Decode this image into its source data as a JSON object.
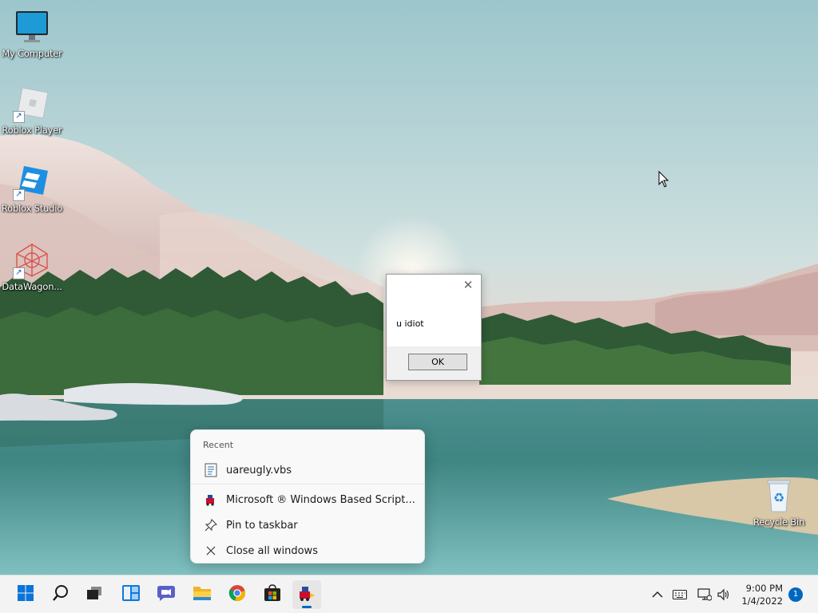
{
  "desktop": {
    "icons": [
      {
        "label": "My Computer",
        "icon": "monitor-icon"
      },
      {
        "label": "Roblox Player",
        "icon": "roblox-player-icon"
      },
      {
        "label": "Roblox Studio",
        "icon": "roblox-studio-icon"
      },
      {
        "label": "DataWagon...",
        "icon": "datawagon-icon"
      },
      {
        "label": "Recycle Bin",
        "icon": "recycle-bin-icon"
      }
    ]
  },
  "dialog": {
    "message": "u idiot",
    "ok_label": "OK",
    "close_glyph": "✕"
  },
  "jumplist": {
    "heading": "Recent",
    "items": [
      {
        "label": "uareugly.vbs",
        "icon": "script-file-icon"
      },
      {
        "label": "Microsoft ® Windows Based Script...",
        "icon": "wscript-app-icon"
      },
      {
        "label": "Pin to taskbar",
        "icon": "pin-icon"
      },
      {
        "label": "Close all windows",
        "icon": "close-icon"
      }
    ]
  },
  "taskbar": {
    "apps": [
      "start-icon",
      "search-icon",
      "task-view-icon",
      "widgets-icon",
      "chat-icon",
      "file-explorer-icon",
      "chrome-icon",
      "store-icon",
      "wscript-app-icon"
    ],
    "clock": {
      "time": "9:00 PM",
      "date": "1/4/2022"
    },
    "notification_count": "1",
    "accent": "#0067c0"
  }
}
